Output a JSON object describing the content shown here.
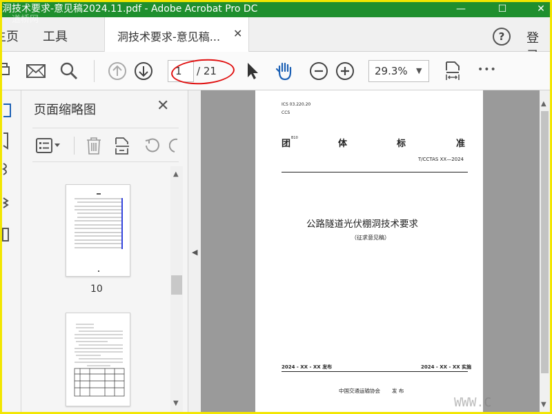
{
  "window": {
    "title": "洞技术要求-意见稿2024.11.pdf - Adobe Acrobat Pro DC",
    "minimize": "—",
    "maximize": "☐",
    "close": "✕"
  },
  "menubar": {
    "home": "主页",
    "tools": "工具",
    "tab_label": "洞技术要求-意见稿...",
    "tab_close": "✕",
    "help": "?",
    "login": "登录"
  },
  "toolbar": {
    "current_page": "1",
    "total_pages": "/ 21",
    "zoom": "29.3%",
    "more": "•••"
  },
  "thumb_panel": {
    "title": "页面缩略图",
    "close": "✕",
    "thumb1_label": "10"
  },
  "document": {
    "ics": "ICS 03.220.20",
    "ccs": "CCS",
    "std_chars": [
      "团",
      "体",
      "标",
      "准"
    ],
    "tuan_sup": "B10",
    "std_number": "T/CCTAS XX—2024",
    "title": "公路隧道光伏棚洞技术要求",
    "subtitle": "（征求意见稿）",
    "publish_date": "2024 - XX - XX 发布",
    "implement_date": "2024 - XX - XX 实施",
    "publisher": "中国交通运输协会",
    "publish_word": "发 布"
  },
  "watermarks": {
    "top": "道桥网",
    "bottom": "WWW.C"
  },
  "colors": {
    "titlebar": "#1f8f2e",
    "frame": "#f2e600",
    "annotation": "#e01010"
  }
}
